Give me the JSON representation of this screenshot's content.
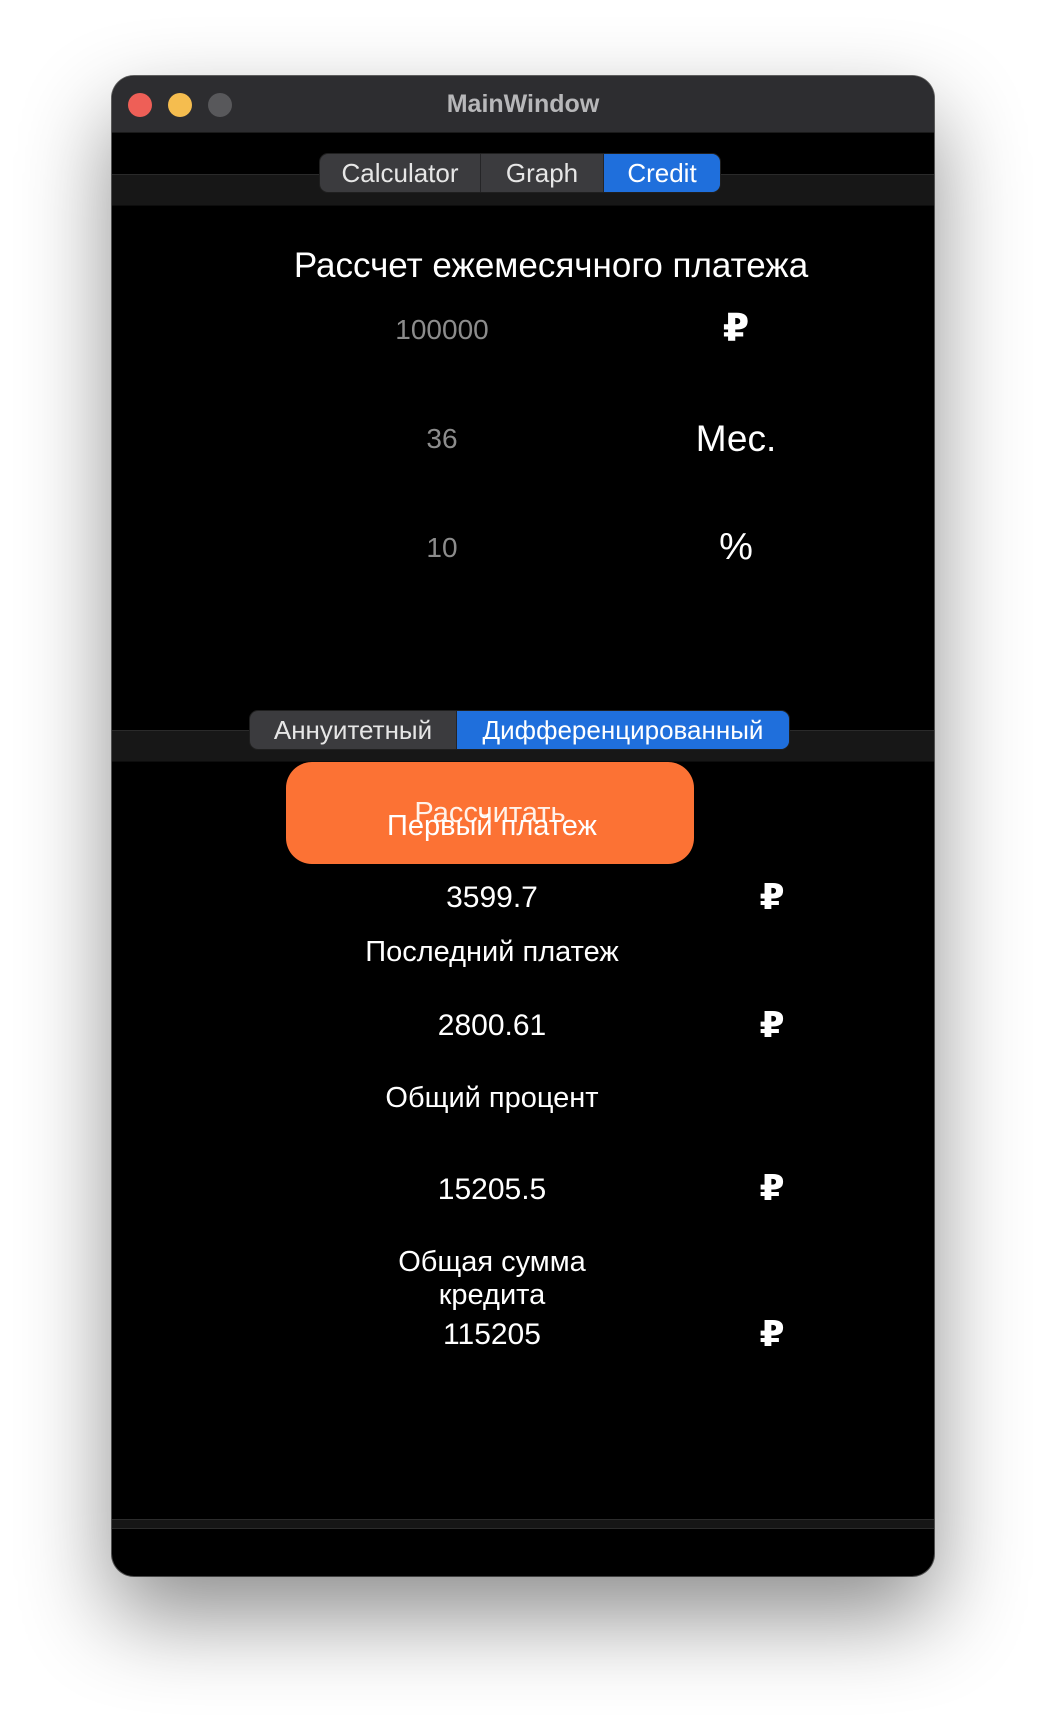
{
  "window": {
    "title": "MainWindow"
  },
  "tabs": {
    "items": [
      {
        "label": "Calculator"
      },
      {
        "label": "Graph"
      },
      {
        "label": "Credit"
      }
    ],
    "selected": "Credit"
  },
  "credit": {
    "heading": "Рассчет ежемесячного платежа",
    "amount": {
      "value": "100000",
      "unit": "₽"
    },
    "term": {
      "value": "36",
      "unit": "Мес."
    },
    "rate": {
      "value": "10",
      "unit": "%"
    },
    "payment_types": [
      {
        "label": "Аннуитетный"
      },
      {
        "label": "Дифференцированный"
      }
    ],
    "selected_payment_type": "Дифференцированный",
    "calculate_label": "Рассчитать",
    "results": [
      {
        "label": "Первый платеж",
        "value": "3599.7",
        "unit": "₽"
      },
      {
        "label": "Последний платеж",
        "value": "2800.61",
        "unit": "₽"
      },
      {
        "label": "Общий процент",
        "value": "15205.5",
        "unit": "₽"
      },
      {
        "label": "Общая сумма кредита",
        "value": "115205",
        "unit": "₽"
      }
    ]
  },
  "colors": {
    "accent": "#1f6fdc",
    "button": "#fc7234",
    "background": "#000000"
  }
}
